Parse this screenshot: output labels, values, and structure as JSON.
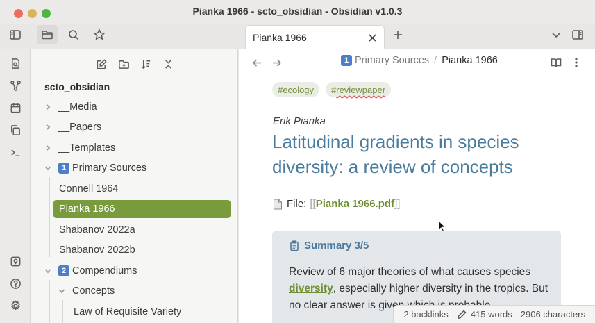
{
  "window": {
    "title": "Pianka 1966 - scto_obsidian - Obsidian v1.0.3"
  },
  "tabs": [
    {
      "label": "Pianka 1966",
      "active": true
    }
  ],
  "ribbon": {
    "icons": [
      "quick-switcher-icon",
      "graph-icon",
      "calendar-icon",
      "copy-icon",
      "terminal-icon",
      "vault-icon",
      "help-icon",
      "settings-icon"
    ]
  },
  "sidebar": {
    "vault_name": "scto_obsidian",
    "items": [
      {
        "label": "__Media",
        "type": "folder",
        "expanded": false
      },
      {
        "label": "__Papers",
        "type": "folder",
        "expanded": false
      },
      {
        "label": "__Templates",
        "type": "folder",
        "expanded": false
      },
      {
        "label": "Primary Sources",
        "badge": "1",
        "type": "folder",
        "expanded": true
      },
      {
        "label": "Connell 1964",
        "type": "file"
      },
      {
        "label": "Pianka 1966",
        "type": "file",
        "active": true
      },
      {
        "label": "Shabanov 2022a",
        "type": "file"
      },
      {
        "label": "Shabanov 2022b",
        "type": "file"
      },
      {
        "label": "Compendiums",
        "badge": "2",
        "type": "folder",
        "expanded": true
      },
      {
        "label": "Concepts",
        "type": "folder",
        "expanded": true
      },
      {
        "label": "Law of Requisite Variety",
        "type": "file"
      }
    ]
  },
  "breadcrumb": {
    "badge": "1",
    "folder": "Primary Sources",
    "separator": "/",
    "current": "Pianka 1966"
  },
  "note": {
    "tags": [
      "#ecology",
      "#reviewpaper"
    ],
    "author": "Erik Pianka",
    "title": "Latitudinal gradients in species diversity: a review of concepts",
    "file_label": "File:",
    "file_link": "Pianka 1966.pdf",
    "callout": {
      "title": "Summary 3/5",
      "body_before": "Review of 6 major theories of what causes species ",
      "body_link": "diversity",
      "body_after": ", especially higher diversity in the tropics. But no clear answer is given which is probable."
    }
  },
  "status_bar": {
    "backlinks": "2 backlinks",
    "words": "415 words",
    "characters": "2906 characters"
  },
  "colors": {
    "accent": "#7a9b3c",
    "title_blue": "#4a7c9d",
    "badge_blue": "#4b7fc9"
  }
}
